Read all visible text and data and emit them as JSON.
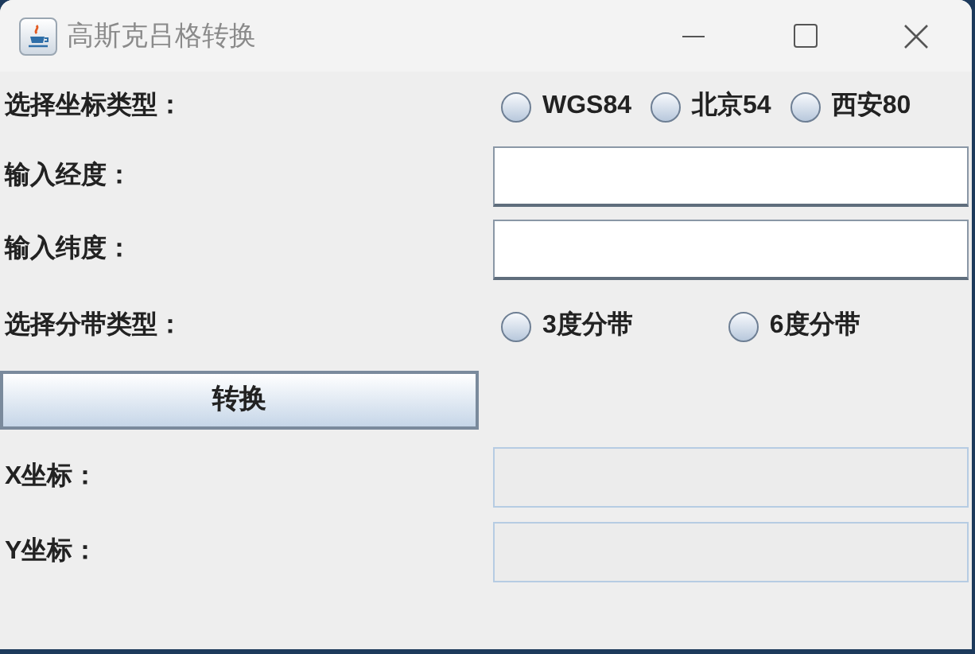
{
  "window": {
    "title": "高斯克吕格转换"
  },
  "coordinate_type": {
    "label": "选择坐标类型：",
    "options": [
      {
        "label": "WGS84",
        "selected": false
      },
      {
        "label": "北京54",
        "selected": false
      },
      {
        "label": "西安80",
        "selected": false
      }
    ]
  },
  "longitude": {
    "label": "输入经度：",
    "disabled": false
  },
  "latitude": {
    "label": "输入纬度：",
    "disabled": false
  },
  "zone_type": {
    "label": "选择分带类型：",
    "options": [
      {
        "label": "3度分带",
        "selected": false
      },
      {
        "label": "6度分带",
        "selected": false
      }
    ]
  },
  "convert_button": {
    "label": "转换"
  },
  "x_coordinate": {
    "label": "X坐标：",
    "disabled": true
  },
  "y_coordinate": {
    "label": "Y坐标：",
    "disabled": true
  }
}
